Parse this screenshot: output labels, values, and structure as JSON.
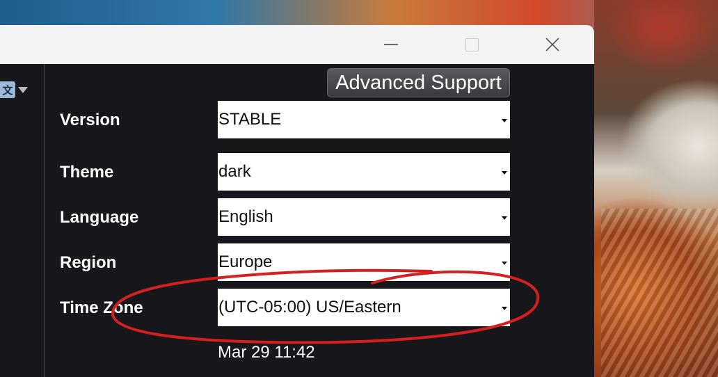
{
  "window": {
    "controls": {
      "minimize_icon": "minimize-icon",
      "maximize_icon": "maximize-icon",
      "close_icon": "close-icon"
    }
  },
  "sidebar": {
    "translate_icon_glyph": "文"
  },
  "header": {
    "advanced_support_label": "Advanced Support"
  },
  "settings": [
    {
      "label": "Version",
      "value": "STABLE"
    },
    {
      "label": "Theme",
      "value": "dark"
    },
    {
      "label": "Language",
      "value": "English"
    },
    {
      "label": "Region",
      "value": "Europe"
    },
    {
      "label": "Time Zone",
      "value": "(UTC-05:00) US/Eastern"
    }
  ],
  "clock": "Mar 29 11:42",
  "colors": {
    "annotation": "#d42020",
    "panel_bg": "#17171c",
    "titlebar_bg": "#f3f3f3"
  }
}
